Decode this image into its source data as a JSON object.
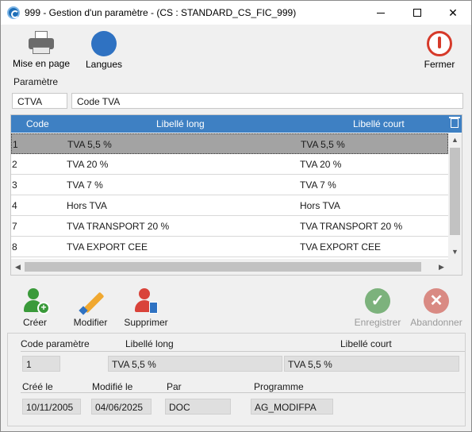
{
  "window": {
    "title": "999 - Gestion d'un paramètre - (CS : STANDARD_CS_FIC_999)",
    "minimize": "—",
    "maximize": "☐",
    "close": "✕"
  },
  "toolbar": {
    "print_label": "Mise en page",
    "languages_label": "Langues",
    "close_label": "Fermer"
  },
  "parameter": {
    "section_label": "Paramètre",
    "code_value": "CTVA",
    "label_value": "Code TVA"
  },
  "grid": {
    "columns": {
      "code": "Code",
      "long": "Libellé long",
      "short": "Libellé court"
    },
    "rows": [
      {
        "code": "1",
        "long": "TVA 5,5 %",
        "short": "TVA 5,5 %",
        "selected": true
      },
      {
        "code": "2",
        "long": "TVA 20 %",
        "short": "TVA 20 %",
        "selected": false
      },
      {
        "code": "3",
        "long": "TVA 7 %",
        "short": "TVA 7 %",
        "selected": false
      },
      {
        "code": "4",
        "long": "Hors TVA",
        "short": "Hors TVA",
        "selected": false
      },
      {
        "code": "7",
        "long": "TVA TRANSPORT 20 %",
        "short": "TVA TRANSPORT 20 %",
        "selected": false
      },
      {
        "code": "8",
        "long": "TVA EXPORT CEE",
        "short": "TVA EXPORT CEE",
        "selected": false
      }
    ]
  },
  "actions": {
    "create_label": "Créer",
    "modify_label": "Modifier",
    "delete_label": "Supprimer",
    "save_label": "Enregistrer",
    "cancel_label": "Abandonner"
  },
  "detail": {
    "code_label": "Code paramètre",
    "long_label": "Libellé long",
    "short_label": "Libellé court",
    "code_value": "1",
    "long_value": "TVA 5,5 %",
    "short_value": "TVA 5,5 %",
    "created_label": "Créé le",
    "modified_label": "Modifié le",
    "by_label": "Par",
    "program_label": "Programme",
    "created_value": "10/11/2005",
    "modified_value": "04/06/2025",
    "by_value": "DOC",
    "program_value": "AG_MODIFPA"
  },
  "colors": {
    "header_blue": "#3e80c3",
    "selected_row": "#a3a3a3",
    "close_red": "#d63a2a"
  }
}
